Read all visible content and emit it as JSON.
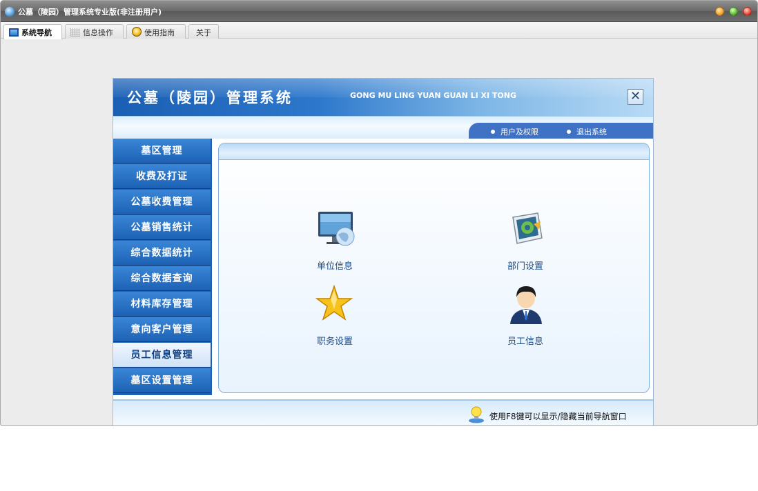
{
  "window": {
    "title": "公墓（陵园）管理系统专业版(非注册用户)"
  },
  "tabs": [
    {
      "label": "系统导航",
      "active": true,
      "icon": "monitor-icon"
    },
    {
      "label": "信息操作",
      "active": false,
      "icon": "grid-icon"
    },
    {
      "label": "使用指南",
      "active": false,
      "icon": "smiley-icon"
    },
    {
      "label": "关于",
      "active": false
    }
  ],
  "panel": {
    "title": "公墓（陵园）管理系统",
    "subtitle": "GONG MU LING YUAN GUAN LI XI TONG",
    "close_symbol": "✕",
    "user_links": [
      "用户及权限",
      "退出系统"
    ]
  },
  "sidebar": {
    "items": [
      {
        "label": "墓区管理"
      },
      {
        "label": "收费及打证"
      },
      {
        "label": "公墓收费管理"
      },
      {
        "label": "公墓销售统计"
      },
      {
        "label": "综合数据统计"
      },
      {
        "label": "综合数据查询"
      },
      {
        "label": "材料库存管理"
      },
      {
        "label": "意向客户管理"
      },
      {
        "label": "员工信息管理",
        "active": true
      },
      {
        "label": "墓区设置管理"
      }
    ]
  },
  "tiles": [
    {
      "label": "单位信息",
      "icon": "monitor-globe-icon"
    },
    {
      "label": "部门设置",
      "icon": "settings-screen-icon"
    },
    {
      "label": "职务设置",
      "icon": "star-icon"
    },
    {
      "label": "员工信息",
      "icon": "person-icon"
    }
  ],
  "footer": {
    "hint": "使用F8键可以显示/隐藏当前导航窗口",
    "icon": "lightbulb-icon"
  },
  "colors": {
    "banner_blue": "#1a5fb4",
    "nav_blue": "#1d62b5",
    "accent_light": "#b9d9f5"
  }
}
